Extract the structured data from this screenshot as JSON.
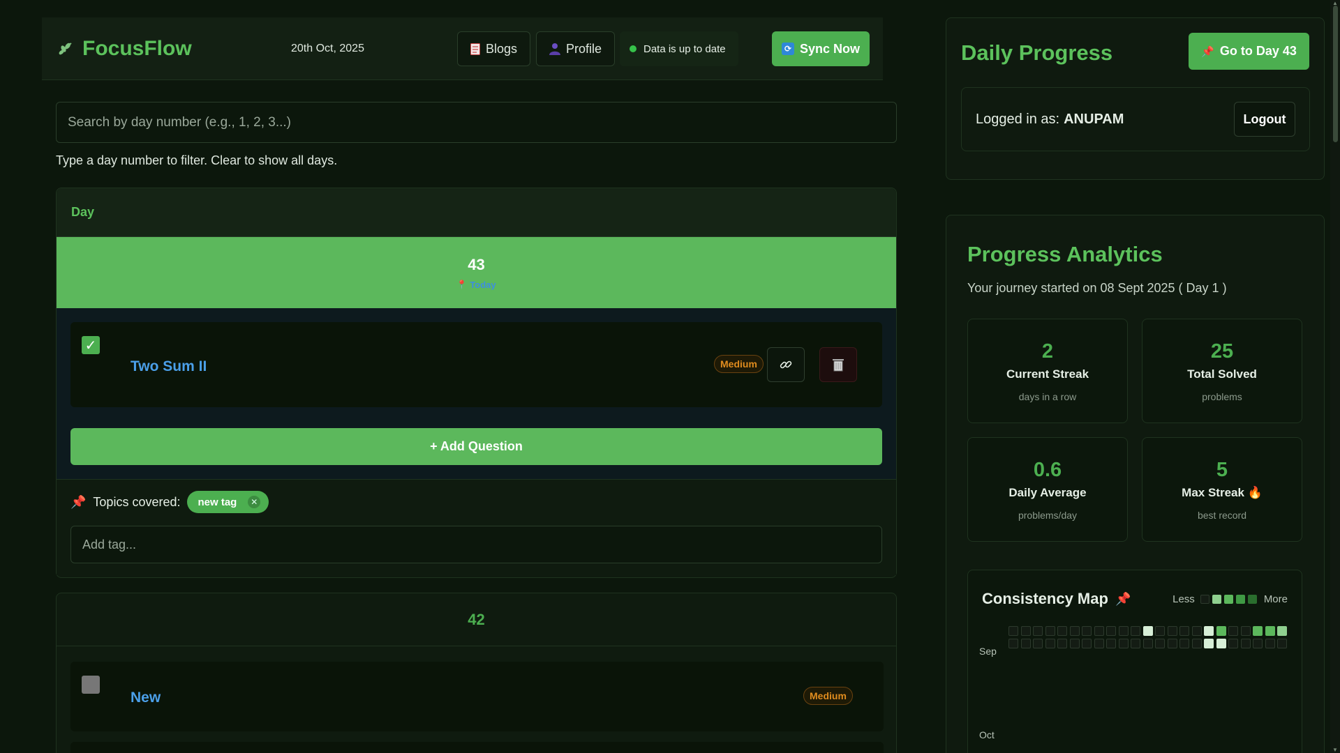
{
  "header": {
    "app_name": "FocusFlow",
    "date": "20th Oct, 2025",
    "blogs_label": "Blogs",
    "profile_label": "Profile",
    "status_text": "Data is up to date",
    "sync_label": "Sync Now"
  },
  "search": {
    "placeholder": "Search by day number (e.g., 1, 2, 3...)",
    "hint": "Type a day number to filter. Clear to show all days."
  },
  "table": {
    "column_header": "Day"
  },
  "days": [
    {
      "number": "43",
      "today_label": "Today",
      "questions": [
        {
          "title": "Two Sum II",
          "difficulty": "Medium",
          "checked": true
        }
      ],
      "add_question_label": "+ Add Question",
      "topics_label": "Topics covered:",
      "tags": [
        "new tag"
      ],
      "tag_placeholder": "Add tag..."
    },
    {
      "number": "42",
      "questions": [
        {
          "title": "New",
          "difficulty": "Medium",
          "checked": false
        }
      ]
    }
  ],
  "daily_progress": {
    "title": "Daily Progress",
    "goto_label": "Go to Day 43",
    "logged_in_prefix": "Logged in as:",
    "username": "ANUPAM",
    "logout_label": "Logout"
  },
  "analytics": {
    "title": "Progress Analytics",
    "subtitle": "Your journey started on 08 Sept 2025 ( Day 1 )",
    "stats": [
      {
        "value": "2",
        "label": "Current Streak",
        "sub": "days in a row"
      },
      {
        "value": "25",
        "label": "Total Solved",
        "sub": "problems"
      },
      {
        "value": "0.6",
        "label": "Daily Average",
        "sub": "problems/day"
      },
      {
        "value": "5",
        "label": "Max Streak",
        "sub": "best record"
      }
    ],
    "consistency": {
      "title": "Consistency Map",
      "less_label": "Less",
      "more_label": "More",
      "months": [
        "Sep",
        "Oct"
      ]
    }
  },
  "colors": {
    "accent": "#4caf50",
    "link": "#4b9fe8",
    "medium": "#e08c1e"
  }
}
